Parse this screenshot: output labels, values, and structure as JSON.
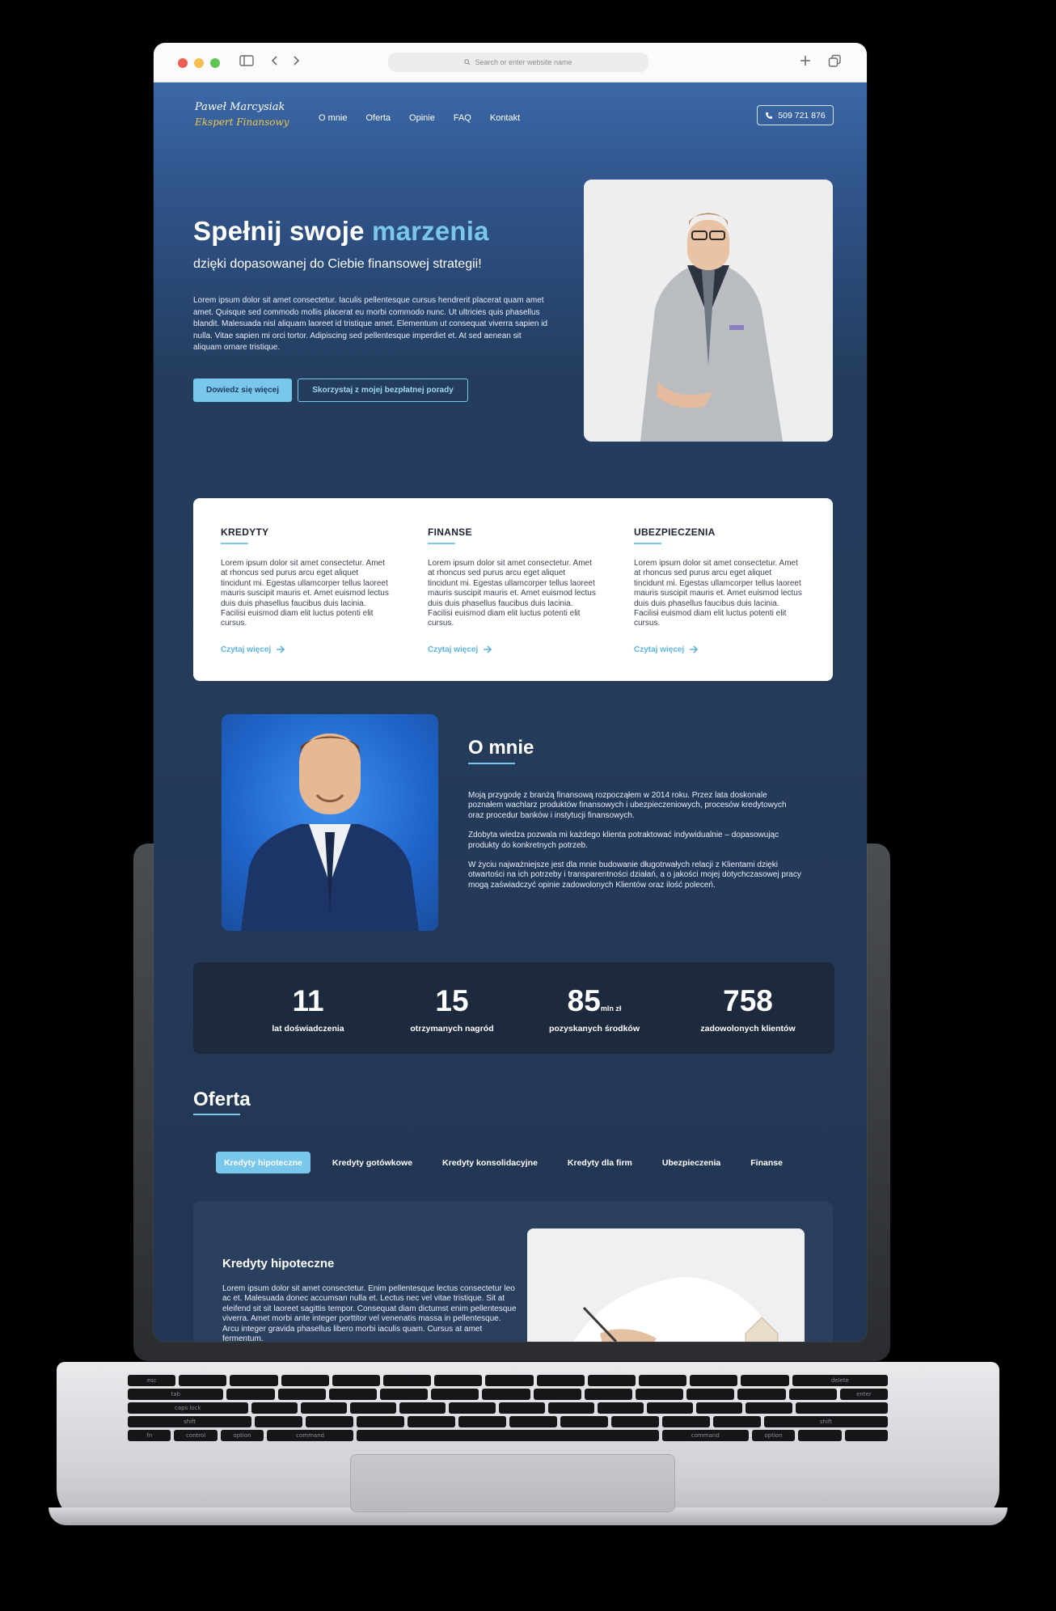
{
  "browser": {
    "address_placeholder": "Search or enter website name",
    "back_icon": "chevron-left-icon",
    "forward_icon": "chevron-right-icon",
    "new_tab_icon": "plus-icon",
    "tabs_icon": "tabs-overview-icon",
    "sidebar_icon": "sidebar-icon"
  },
  "nav": {
    "logo_line1": "Paweł Marcysiak",
    "logo_line2": "Ekspert Finansowy",
    "menu": [
      "O mnie",
      "Oferta",
      "Opinie",
      "FAQ",
      "Kontakt"
    ],
    "phone": "509 721 876"
  },
  "hero": {
    "title_plain": "Spełnij swoje",
    "title_accent": "marzenia",
    "subtitle": "dzięki dopasowanej do Ciebie finansowej strategii!",
    "body": "Lorem ipsum dolor sit amet consectetur. Iaculis pellentesque cursus hendrerit placerat quam amet amet. Quisque sed commodo mollis placerat eu morbi commodo nunc. Ut ultricies quis phasellus blandit. Malesuada nisl aliquam laoreet id tristique amet. Elementum ut consequat viverra sapien id nulla. Vitae sapien mi orci tortor. Adipiscing sed pellentesque imperdiet et. At sed aenean sit aliquam ornare tristique.",
    "cta_primary": "Dowiedz się więcej",
    "cta_secondary": "Skorzystaj z mojej bezpłatnej porady"
  },
  "services": [
    {
      "title": "KREDYTY",
      "text": "Lorem ipsum dolor sit amet consectetur. Amet at rhoncus sed purus arcu eget aliquet tincidunt mi. Egestas ullamcorper tellus laoreet mauris suscipit mauris et. Amet euismod lectus duis duis phasellus faucibus duis lacinia. Facilisi euismod diam elit luctus potenti elit cursus.",
      "link": "Czytaj więcej"
    },
    {
      "title": "FINANSE",
      "text": "Lorem ipsum dolor sit amet consectetur. Amet at rhoncus sed purus arcu eget aliquet tincidunt mi. Egestas ullamcorper tellus laoreet mauris suscipit mauris et. Amet euismod lectus duis duis phasellus faucibus duis lacinia. Facilisi euismod diam elit luctus potenti elit cursus.",
      "link": "Czytaj więcej"
    },
    {
      "title": "UBEZPIECZENIA",
      "text": "Lorem ipsum dolor sit amet consectetur. Amet at rhoncus sed purus arcu eget aliquet tincidunt mi. Egestas ullamcorper tellus laoreet mauris suscipit mauris et. Amet euismod lectus duis duis phasellus faucibus duis lacinia. Facilisi euismod diam elit luctus potenti elit cursus.",
      "link": "Czytaj więcej"
    }
  ],
  "about": {
    "title": "O mnie",
    "paragraphs": [
      "Moją  przygodę z branżą finansową rozpocząłem w 2014 roku. Przez lata  doskonale poznałem wachlarz produktów finansowych i ubezpieczeniowych,  procesów kredytowych oraz procedur banków i instytucji finansowych.",
      "Zdobyta wiedza pozwala mi każdego klienta potraktować indywidualnie – dopasowując produkty do konkretnych potrzeb.",
      "W życiu najważniejsze jest  dla mnie budowanie długotrwałych relacji z Klientami dzięki otwartości  na ich potrzeby i transparentności działań, a o jakości mojej dotychczasowej pracy mogą zaświadczyć opinie zadowolonych Klientów oraz  ilość poleceń."
    ]
  },
  "stats": [
    {
      "value": "11",
      "unit": "",
      "label": "lat doświadczenia"
    },
    {
      "value": "15",
      "unit": "",
      "label": "otrzymanych nagród"
    },
    {
      "value": "85",
      "unit": "mln zł",
      "label": "pozyskanych środków"
    },
    {
      "value": "758",
      "unit": "",
      "label": "zadowolonych klientów"
    }
  ],
  "offer": {
    "title": "Oferta",
    "tabs": [
      "Kredyty hipoteczne",
      "Kredyty gotówkowe",
      "Kredyty konsolidacyjne",
      "Kredyty dla firm",
      "Ubezpieczenia",
      "Finanse"
    ],
    "active_tab": 0,
    "card_title": "Kredyty hipoteczne",
    "card_text": "Lorem ipsum dolor sit amet consectetur. Enim pellentesque lectus consectetur leo ac et. Malesuada donec accumsan nulla et. Lectus nec vel vitae tristique. Sit at eleifend sit sit laoreet sagittis tempor. Consequat diam dictumst enim pellentesque viverra. Amet morbi ante integer porttitor vel venenatis massa in pellentesque. Arcu integer gravida phasellus libero morbi iaculis quam. Cursus at amet fermentum."
  },
  "keyboard": {
    "labels": [
      "esc",
      "tab",
      "caps lock",
      "shift",
      "fn",
      "control",
      "option",
      "command",
      "command",
      "option",
      "delete",
      "enter",
      "shift"
    ]
  },
  "colors": {
    "accent": "#7ac7ec",
    "page_bg_top": "#3b68a7",
    "page_bg": "#243d5f",
    "logo_yellow": "#f2c84b",
    "stats_bg": "#1d2a3e"
  }
}
